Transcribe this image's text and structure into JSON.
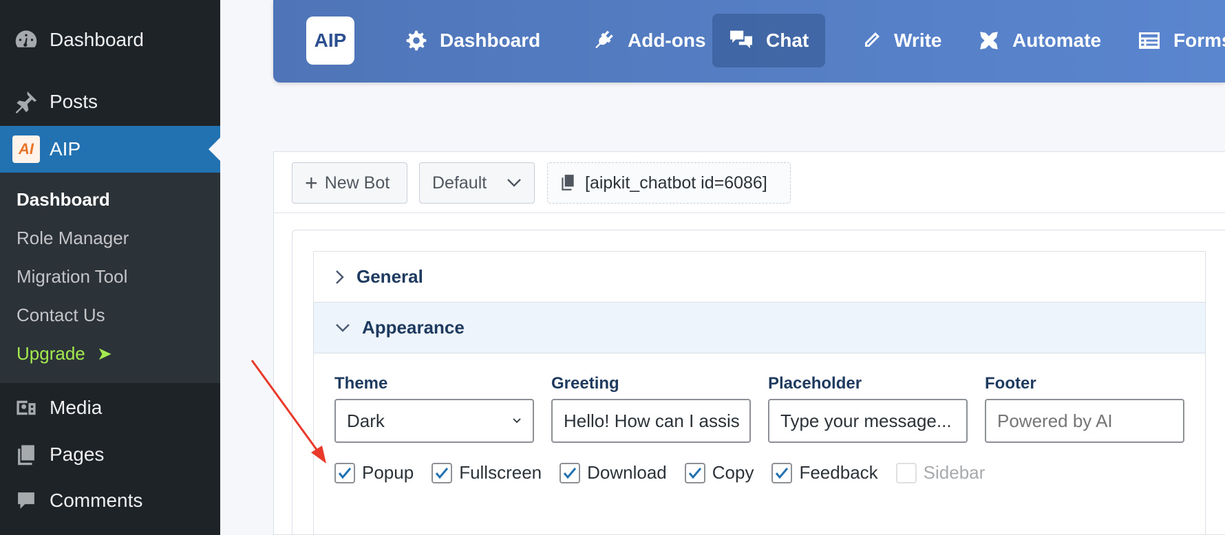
{
  "sidebar": {
    "dashboard": "Dashboard",
    "posts": "Posts",
    "aip": "AIP",
    "aip_icon": "AI",
    "submenu": [
      "Dashboard",
      "Role Manager",
      "Migration Tool",
      "Contact Us",
      "Upgrade"
    ],
    "upgrade_arrow": "➤",
    "media": "Media",
    "pages": "Pages",
    "comments": "Comments"
  },
  "topnav": {
    "logo": "AIP",
    "items": [
      "Dashboard",
      "Add-ons",
      "Chat",
      "Write",
      "Automate",
      "Forms"
    ],
    "active": "Chat"
  },
  "toolbar": {
    "new_bot": "New Bot",
    "bot_select": "Default",
    "shortcode": "[aipkit_chatbot id=6086]"
  },
  "accordion": {
    "general": "General",
    "appearance": "Appearance"
  },
  "appearance": {
    "theme_label": "Theme",
    "theme_value": "Dark",
    "greeting_label": "Greeting",
    "greeting_value": "Hello! How can I assis",
    "placeholder_label": "Placeholder",
    "placeholder_value": "Type your message...",
    "footer_label": "Footer",
    "footer_placeholder": "Powered by AI",
    "checkboxes": [
      {
        "label": "Popup",
        "checked": true
      },
      {
        "label": "Fullscreen",
        "checked": true
      },
      {
        "label": "Download",
        "checked": true
      },
      {
        "label": "Copy",
        "checked": true
      },
      {
        "label": "Feedback",
        "checked": true
      },
      {
        "label": "Sidebar",
        "checked": false
      }
    ]
  },
  "colors": {
    "sidebar_bg": "#1d2327",
    "sidebar_active": "#2271b1",
    "topbar": "#5a86cf",
    "upgrade": "#a4e94f",
    "annotation_arrow": "#e8392a"
  }
}
